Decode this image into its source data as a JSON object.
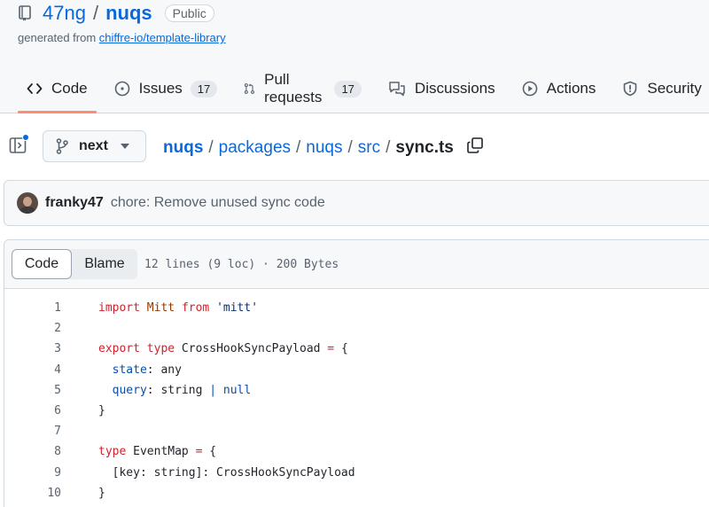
{
  "repo": {
    "owner": "47ng",
    "separator": "/",
    "name": "nuqs",
    "visibility": "Public",
    "generated_prefix": "generated from ",
    "template_link": "chiffre-io/template-library"
  },
  "tabs": [
    {
      "label": "Code",
      "icon": "code-icon",
      "active": true
    },
    {
      "label": "Issues",
      "icon": "issue-icon",
      "count": "17"
    },
    {
      "label": "Pull requests",
      "icon": "pull-request-icon",
      "count": "17"
    },
    {
      "label": "Discussions",
      "icon": "discussions-icon"
    },
    {
      "label": "Actions",
      "icon": "play-icon"
    },
    {
      "label": "Security",
      "icon": "shield-icon"
    }
  ],
  "file_nav": {
    "branch": "next",
    "breadcrumb": [
      "nuqs",
      "packages",
      "nuqs",
      "src",
      "sync.ts"
    ],
    "separator": "/"
  },
  "commit": {
    "author": "franky47",
    "message": "chore: Remove unused sync code"
  },
  "file": {
    "view_code": "Code",
    "view_blame": "Blame",
    "info": "12 lines (9 loc) · 200 Bytes",
    "lines": [
      {
        "n": "1",
        "text": "import Mitt from 'mitt'"
      },
      {
        "n": "2",
        "text": ""
      },
      {
        "n": "3",
        "text": "export type CrossHookSyncPayload = {"
      },
      {
        "n": "4",
        "text": "  state: any"
      },
      {
        "n": "5",
        "text": "  query: string | null"
      },
      {
        "n": "6",
        "text": "}"
      },
      {
        "n": "7",
        "text": ""
      },
      {
        "n": "8",
        "text": "type EventMap = {"
      },
      {
        "n": "9",
        "text": "  [key: string]: CrossHookSyncPayload"
      },
      {
        "n": "10",
        "text": "}"
      }
    ]
  },
  "colors": {
    "link": "#0969da",
    "active_tab_underline": "#fd8c73",
    "keyword": "#cf222e",
    "string": "#0a3069",
    "entity": "#953800",
    "property": "#0550ae"
  }
}
